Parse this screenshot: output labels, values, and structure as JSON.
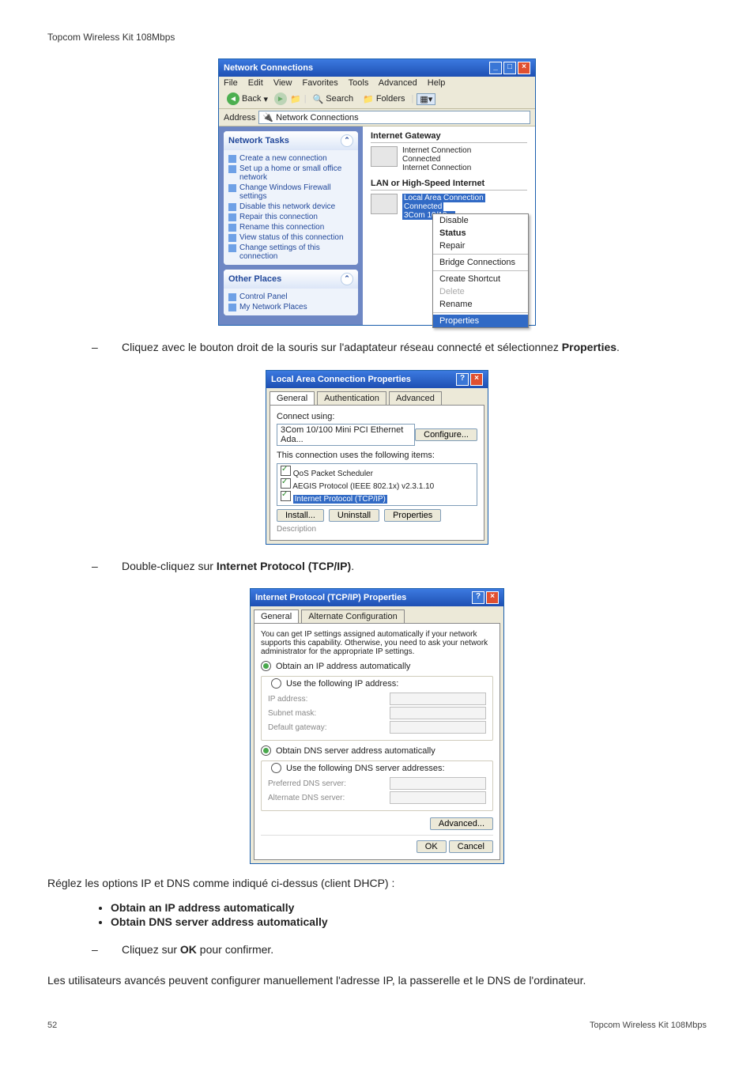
{
  "header": "Topcom Wireless Kit 108Mbps",
  "nc_window": {
    "title": "Network Connections",
    "menu": [
      "File",
      "Edit",
      "View",
      "Favorites",
      "Tools",
      "Advanced",
      "Help"
    ],
    "toolbar": {
      "back": "Back",
      "search": "Search",
      "folders": "Folders"
    },
    "address_label": "Address",
    "address_value": "Network Connections",
    "side": {
      "tasks_title": "Network Tasks",
      "tasks": [
        "Create a new connection",
        "Set up a home or small office network",
        "Change Windows Firewall settings",
        "Disable this network device",
        "Repair this connection",
        "Rename this connection",
        "View status of this connection",
        "Change settings of this connection"
      ],
      "other_title": "Other Places",
      "other": [
        "Control Panel",
        "My Network Places"
      ]
    },
    "main": {
      "section1": "Internet Gateway",
      "conn1_name": "Internet Connection",
      "conn1_status": "Connected",
      "conn1_sub": "Internet Connection",
      "section2": "LAN or High-Speed Internet",
      "conn2_name": "Local Area Connection",
      "conn2_status": "Connected",
      "conn2_sub": "3Com 10/10..."
    },
    "context": [
      "Disable",
      "Status",
      "Repair",
      "Bridge Connections",
      "Create Shortcut",
      "Delete",
      "Rename",
      "Properties"
    ]
  },
  "instr1": "Cliquez avec le bouton droit de la souris sur l'adaptateur réseau connecté et sélectionnez ",
  "instr1_bold": "Properties",
  "lac_dialog": {
    "title": "Local Area Connection Properties",
    "tabs": [
      "General",
      "Authentication",
      "Advanced"
    ],
    "connect_using": "Connect using:",
    "adapter": "3Com 10/100 Mini PCI Ethernet Ada...",
    "configure": "Configure...",
    "items_label": "This connection uses the following items:",
    "items": [
      "QoS Packet Scheduler",
      "AEGIS Protocol (IEEE 802.1x) v2.3.1.10",
      "Internet Protocol (TCP/IP)"
    ],
    "btn_install": "Install...",
    "btn_uninstall": "Uninstall",
    "btn_props": "Properties",
    "desc": "Description"
  },
  "instr2": "Double-cliquez sur ",
  "instr2_bold": "Internet Protocol (TCP/IP)",
  "tcpip_dialog": {
    "title": "Internet Protocol (TCP/IP) Properties",
    "tabs": [
      "General",
      "Alternate Configuration"
    ],
    "blurb": "You can get IP settings assigned automatically if your network supports this capability. Otherwise, you need to ask your network administrator for the appropriate IP settings.",
    "r1": "Obtain an IP address automatically",
    "r2": "Use the following IP address:",
    "f_ip": "IP address:",
    "f_mask": "Subnet mask:",
    "f_gw": "Default gateway:",
    "r3": "Obtain DNS server address automatically",
    "r4": "Use the following DNS server addresses:",
    "f_pdns": "Preferred DNS server:",
    "f_adns": "Alternate DNS server:",
    "advanced": "Advanced...",
    "ok": "OK",
    "cancel": "Cancel"
  },
  "body1": "Réglez les options IP et DNS comme indiqué ci-dessus (client DHCP) :",
  "bullets": [
    "Obtain an IP address automatically",
    "Obtain DNS server address automatically"
  ],
  "instr3a": "Cliquez sur ",
  "instr3b": "OK",
  "instr3c": " pour confirmer.",
  "body2": "Les utilisateurs avancés peuvent configurer manuellement l'adresse IP, la passerelle et le DNS de l'ordinateur.",
  "footer_page": "52",
  "footer_right": "Topcom Wireless Kit 108Mbps"
}
